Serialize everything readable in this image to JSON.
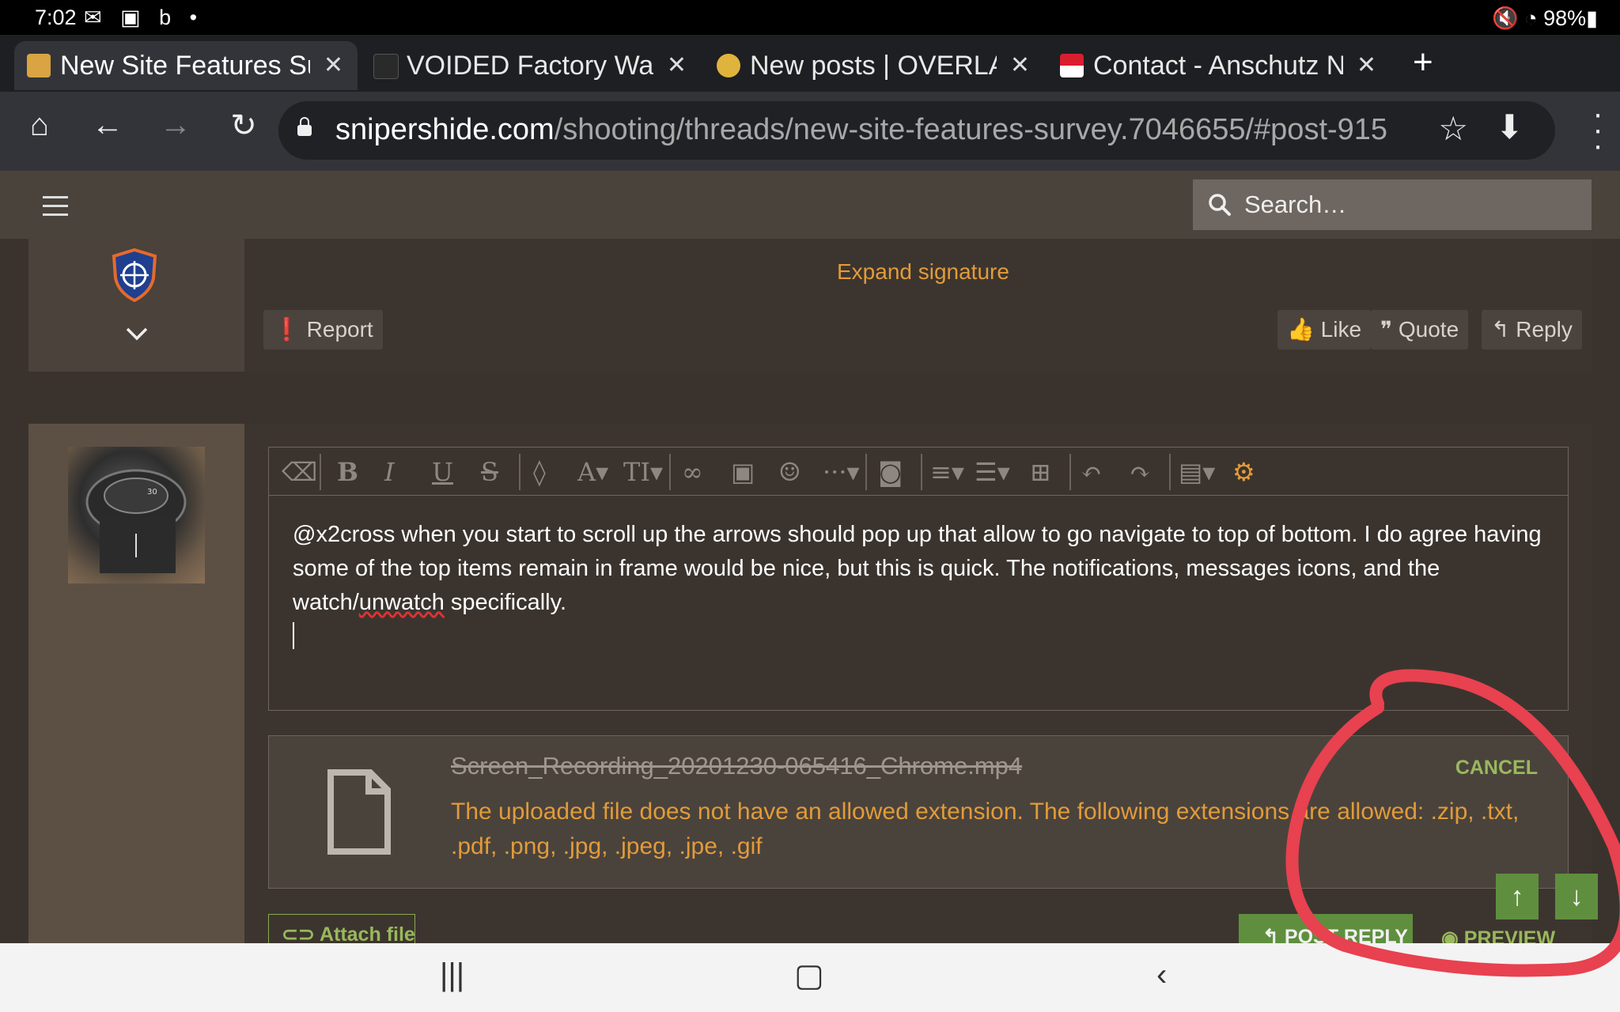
{
  "status_bar": {
    "time": "7:02",
    "left_icons": "✉ ▣ b •",
    "right": "🔇 ◔ 98%▮"
  },
  "tabs": [
    {
      "title": "New Site Features Survey",
      "favicon_color": "#d9a441",
      "active": true
    },
    {
      "title": "VOIDED Factory Warranty",
      "favicon_color": "#2a2a2a",
      "active": false
    },
    {
      "title": "New posts | OVERLAND",
      "favicon_color": "#e0b43c",
      "active": false
    },
    {
      "title": "Contact - Anschutz North",
      "favicon_color": "#d91e2e",
      "active": false
    }
  ],
  "new_tab": "+",
  "address_bar": {
    "url_domain": "snipershide.com",
    "url_path": "/shooting/threads/new-site-features-survey.7046655/#post-915"
  },
  "site_header": {
    "search_placeholder": "Search…"
  },
  "post1": {
    "expand_signature": "Expand signature",
    "report_label": "Report",
    "like_label": "Like",
    "quote_label": "Quote",
    "reply_label": "Reply"
  },
  "editor": {
    "text_before": "@x2cross when you start to scroll up the arrows should pop up that allow to go navigate to top of bottom. I do agree having some of the top items remain in frame would be nice, but this is quick. The notifications, messages icons, and the  watch/",
    "misspelled": "unwatch",
    "text_after": " specifically."
  },
  "attachment": {
    "file_name": "Screen_Recording_20201230-065416_Chrome.mp4",
    "error": "The uploaded file does not have an allowed extension. The following extensions are allowed: .zip, .txt, .pdf, .png, .jpg, .jpeg, .jpe, .gif",
    "cancel_label": "CANCEL"
  },
  "buttons": {
    "attach_files": "Attach files",
    "post_reply": "POST REPLY",
    "preview": "PREVIEW"
  },
  "colors": {
    "accent_orange": "#e29b3a",
    "accent_green": "#5f8f3e",
    "annotation_red": "#e8414f"
  }
}
